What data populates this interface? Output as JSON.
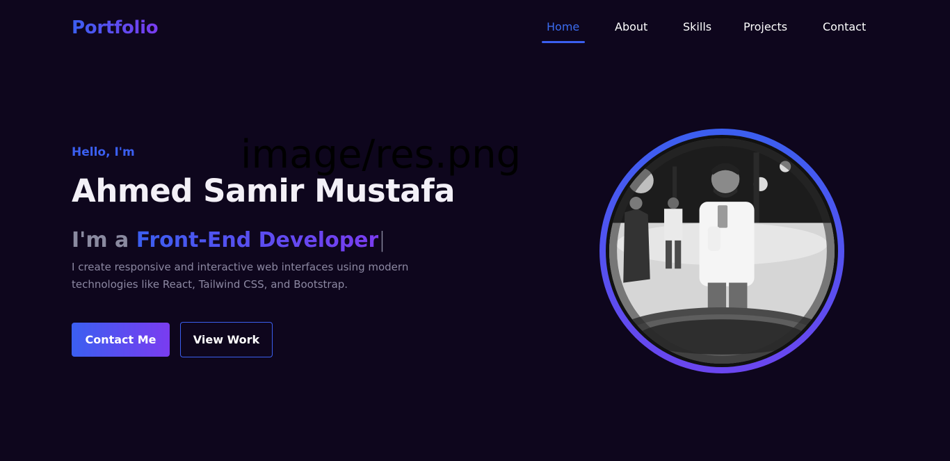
{
  "brand": {
    "logo": "Portfolio",
    "accent": "#3b5ff0",
    "accent2": "#7a3cf0",
    "background": "#0e061d"
  },
  "nav": {
    "items": [
      {
        "label": "Home",
        "active": true
      },
      {
        "label": "About",
        "active": false
      },
      {
        "label": "Skills",
        "active": false
      },
      {
        "label": "Projects",
        "active": false
      },
      {
        "label": "Contact",
        "active": false
      }
    ]
  },
  "hero": {
    "greeting": "Hello, I'm",
    "broken_image_alt": "image/res.png",
    "name": "Ahmed Samir Mustafa",
    "role_prefix": "I'm a ",
    "role_highlight": "Front-End Developer",
    "role_cursor": "|",
    "description": "I create responsive and interactive web interfaces using modern technologies like React, Tailwind CSS, and Bootstrap.",
    "buttons": {
      "primary": "Contact Me",
      "secondary": "View Work"
    }
  },
  "profile": {
    "photo_icon": "profile-photo"
  }
}
